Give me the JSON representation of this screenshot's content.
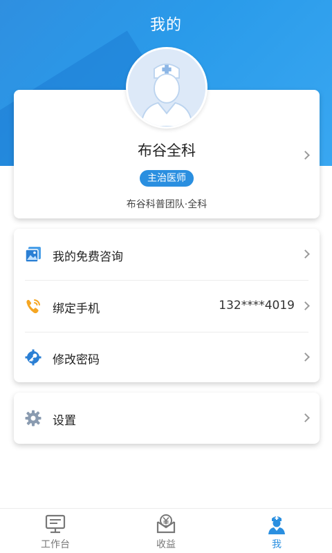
{
  "header": {
    "title": "我的"
  },
  "profile": {
    "name": "布谷全科",
    "badge": "主治医师",
    "team": "布谷科普团队·全科"
  },
  "menu": [
    {
      "label": "我的免费咨询",
      "value": "",
      "icon": "image-gallery-icon"
    },
    {
      "label": "绑定手机",
      "value": "132****4019",
      "icon": "phone-icon"
    },
    {
      "label": "修改密码",
      "value": "",
      "icon": "key-gear-icon"
    }
  ],
  "settings": {
    "label": "设置",
    "icon": "gear-icon"
  },
  "tabbar": {
    "tabs": [
      {
        "label": "工作台",
        "icon": "monitor-icon"
      },
      {
        "label": "收益",
        "icon": "yen-envelope-icon"
      },
      {
        "label": "我",
        "icon": "doctor-icon"
      }
    ],
    "active_index": 2
  },
  "colors": {
    "primary": "#2a8fe0",
    "header_bg": "#2f9be8",
    "phone_icon": "#f5a623",
    "inactive": "#777777"
  }
}
